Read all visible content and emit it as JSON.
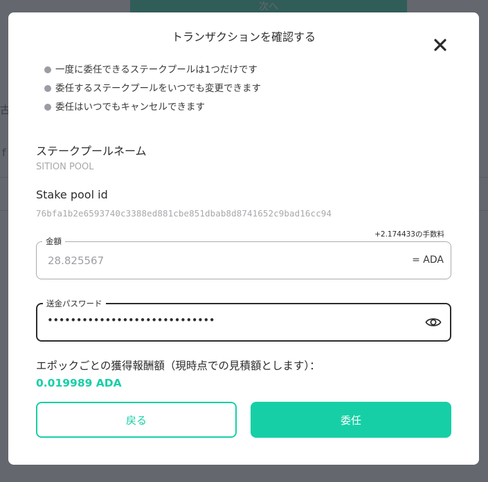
{
  "background": {
    "next_button": "次へ",
    "fragment_1": "古",
    "fragment_2": "f"
  },
  "modal": {
    "title": "トランザクションを確認する",
    "close_icon": "close-icon",
    "notes": [
      "一度に委任できるステークプールは1つだけです",
      "委任するステークプールをいつでも変更できます",
      "委任はいつでもキャンセルできます"
    ],
    "pool_name_label": "ステークプールネーム",
    "pool_name_value": "SITION POOL",
    "pool_id_label": "Stake pool id",
    "pool_id_value": "76bfa1b2e6593740c3388ed881cbe851dbab8d8741652c9bad16cc94",
    "fee": "+2.174433の手数料",
    "amount": {
      "label": "金額",
      "value": "28.825567",
      "unit": "= ADA"
    },
    "password": {
      "label": "送金パスワード",
      "value": "•••••••••••••••••••••••••••••",
      "toggle_icon": "eye-icon"
    },
    "reward_label": "エポックごとの獲得報酬額（現時点での見積額とします）：",
    "reward_value": "0.019989 ADA",
    "back_label": "戻る",
    "delegate_label": "委任"
  },
  "colors": {
    "accent": "#17cfa6",
    "overlay": "#383c44",
    "text": "#2b2b2b",
    "muted": "#a6a8ad"
  }
}
